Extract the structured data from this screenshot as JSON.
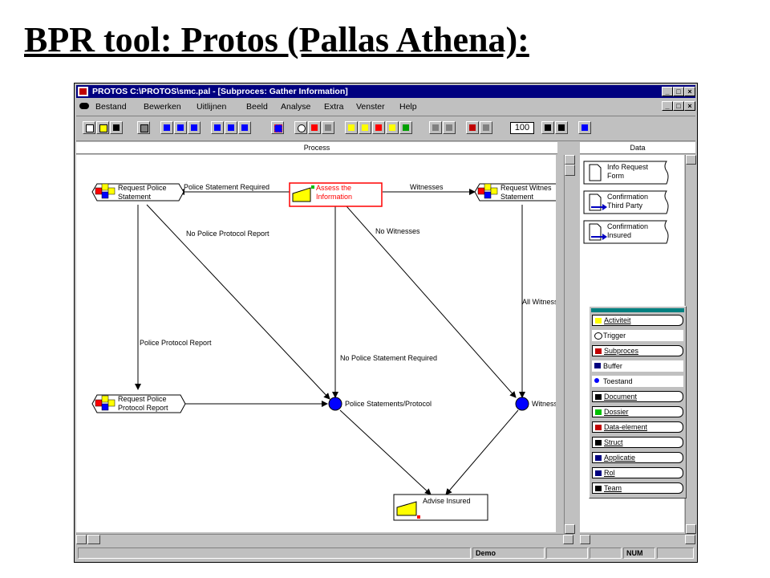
{
  "slide": {
    "title": "BPR tool: Protos (Pallas Athena):"
  },
  "window": {
    "title": "PROTOS C:\\PROTOS\\smc.pal - [Subproces: Gather Information]",
    "controls": {
      "minimize": "_",
      "restore": "□",
      "close": "×"
    }
  },
  "menu": [
    "Bestand",
    "Bewerken",
    "Uitlijnen",
    "Beeld",
    "Analyse",
    "Extra",
    "Venster",
    "Help"
  ],
  "toolbar": {
    "buttons": [
      "new-icon",
      "open-icon",
      "save-icon",
      "print-icon",
      "align-left-icon",
      "align-center-icon",
      "align-right-icon",
      "align-top-icon",
      "align-middle-icon",
      "align-bottom-icon",
      "grid-icon",
      "ellipse-icon",
      "shapes-icon",
      "pointer-icon",
      "chart-icon-1",
      "chart-icon-2",
      "chart-icon-3",
      "chart-icon-4",
      "chart-icon-5",
      "graph-icon-1",
      "graph-icon-2",
      "zoom-icon",
      "fit-icon"
    ],
    "zoom_value": "100",
    "nav": [
      "rewind-icon",
      "forward-icon",
      "help-pointer-icon"
    ]
  },
  "panes": {
    "process": "Process",
    "data": "Data"
  },
  "process": {
    "nodes": {
      "request_police_statement": "Request Police\nStatement",
      "assess": "Assess the\nInformation",
      "request_witness": "Request Witnes\nStatement",
      "request_police_protocol": "Request Police\nProtocol Report",
      "police_statements_protocol": "Police Statements/Protocol",
      "witness": "Witness",
      "advise_insured": "Advise Insured"
    },
    "arcs": {
      "police_statement_required": "Police Statement Required",
      "witnesses": "Witnesses",
      "no_police_protocol_report": "No Police Protocol Report",
      "no_witnesses": "No Witnesses",
      "all_witness": "All Witness",
      "police_protocol_report": "Police Protocol Report",
      "no_police_statement_required": "No Police Statement Required"
    }
  },
  "data": {
    "documents": [
      {
        "label": "Info Request\nForm",
        "arrow": false
      },
      {
        "label": "Confirmation\nThird Party",
        "arrow": true
      },
      {
        "label": "Confirmation\nInsured",
        "arrow": true
      }
    ]
  },
  "palette": {
    "items": [
      {
        "label": "Activiteit",
        "icon": "activity-icon",
        "color": "#ffff00",
        "boxed": true
      },
      {
        "label": "Trigger",
        "icon": "trigger-icon",
        "color": "#000000",
        "boxed": false
      },
      {
        "label": "Subproces",
        "icon": "subprocess-icon",
        "color": "#c00000",
        "boxed": true
      },
      {
        "label": "Buffer",
        "icon": "buffer-icon",
        "color": "#000080",
        "boxed": false
      },
      {
        "label": "Toestand",
        "icon": "state-icon",
        "color": "#0000ff",
        "boxed": false
      },
      {
        "label": "Document",
        "icon": "document-icon",
        "color": "#000000",
        "boxed": true
      },
      {
        "label": "Dossier",
        "icon": "dossier-icon",
        "color": "#00c000",
        "boxed": true
      },
      {
        "label": "Data-element",
        "icon": "data-element-icon",
        "color": "#c00000",
        "boxed": true
      },
      {
        "label": "Struct",
        "icon": "struct-icon",
        "color": "#000000",
        "boxed": true
      },
      {
        "label": "Applicatie",
        "icon": "application-icon",
        "color": "#000080",
        "boxed": true
      },
      {
        "label": "Rol",
        "icon": "role-icon",
        "color": "#000080",
        "boxed": true
      },
      {
        "label": "Team",
        "icon": "team-icon",
        "color": "#000000",
        "boxed": true
      }
    ]
  },
  "status": {
    "mode": "Demo",
    "num": "NUM"
  },
  "colors": {
    "titlebar": "#000080",
    "selection": "#ff0000",
    "state": "#0000ff",
    "activity": "#ffff00",
    "palette_title": "#008080"
  }
}
